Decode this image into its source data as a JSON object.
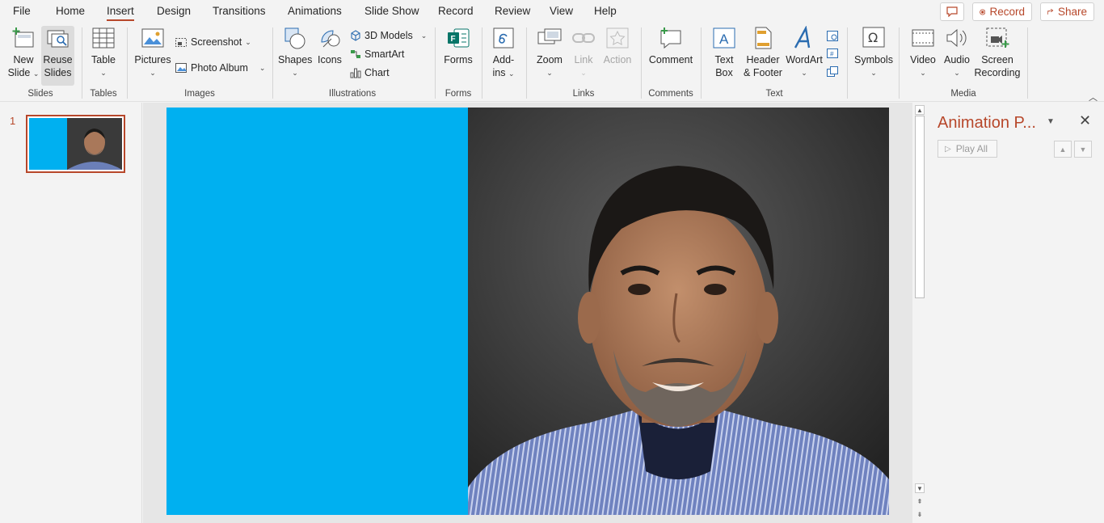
{
  "tabs": [
    {
      "label": "File"
    },
    {
      "label": "Home"
    },
    {
      "label": "Insert"
    },
    {
      "label": "Design"
    },
    {
      "label": "Transitions"
    },
    {
      "label": "Animations"
    },
    {
      "label": "Slide Show"
    },
    {
      "label": "Record"
    },
    {
      "label": "Review"
    },
    {
      "label": "View"
    },
    {
      "label": "Help"
    }
  ],
  "active_tab": "Insert",
  "top_buttons": {
    "record": "Record",
    "share": "Share"
  },
  "ribbon": {
    "slides": {
      "new_slide": "New",
      "new_slide_2": "Slide",
      "reuse": "Reuse",
      "reuse_2": "Slides",
      "label": "Slides"
    },
    "tables": {
      "table": "Table",
      "label": "Tables"
    },
    "images": {
      "pictures": "Pictures",
      "screenshot": "Screenshot",
      "photo_album": "Photo Album",
      "label": "Images"
    },
    "illustrations": {
      "shapes": "Shapes",
      "icons": "Icons",
      "models": "3D Models",
      "smartart": "SmartArt",
      "chart": "Chart",
      "label": "Illustrations"
    },
    "forms": {
      "forms": "Forms",
      "label": "Forms"
    },
    "addins": {
      "addins": "Add-",
      "addins_2": "ins",
      "label": ""
    },
    "links": {
      "zoom": "Zoom",
      "link": "Link",
      "action": "Action",
      "label": "Links"
    },
    "comments": {
      "comment": "Comment",
      "label": "Comments"
    },
    "text": {
      "textbox": "Text",
      "textbox_2": "Box",
      "header": "Header",
      "header_2": "& Footer",
      "wordart": "WordArt",
      "label": "Text"
    },
    "symbols": {
      "symbols": "Symbols"
    },
    "media": {
      "video": "Video",
      "audio": "Audio",
      "screen": "Screen",
      "screen_2": "Recording",
      "label": "Media"
    }
  },
  "slides_pane": {
    "number": "1"
  },
  "slide": {
    "left_color": "#00b0f0"
  },
  "animation_pane": {
    "title": "Animation P...",
    "play_all": "Play All"
  },
  "colors": {
    "accent": "#b7472a",
    "slide_blue": "#00b0f0"
  }
}
